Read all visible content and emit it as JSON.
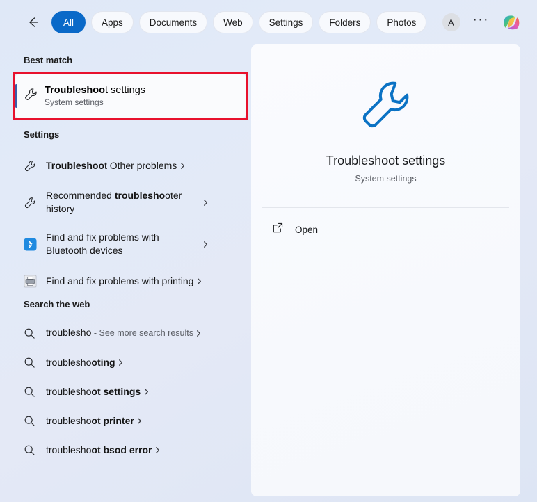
{
  "topbar": {
    "back_icon": "back-arrow-icon",
    "filters": [
      {
        "label": "All",
        "active": true
      },
      {
        "label": "Apps",
        "active": false
      },
      {
        "label": "Documents",
        "active": false
      },
      {
        "label": "Web",
        "active": false
      },
      {
        "label": "Settings",
        "active": false
      },
      {
        "label": "Folders",
        "active": false
      },
      {
        "label": "Photos",
        "active": false
      }
    ],
    "more_icon": "more-filters-arrow-icon",
    "avatar_initial": "A",
    "ellipsis": "···",
    "copilot_icon": "copilot-icon"
  },
  "query": "troublesho",
  "sections": {
    "best_match_header": "Best match",
    "settings_header": "Settings",
    "web_header": "Search the web"
  },
  "best_match": {
    "icon": "wrench-icon",
    "title_bold": "Troubleshoo",
    "title_rest": "t settings",
    "subtitle": "System settings"
  },
  "settings_results": [
    {
      "icon": "wrench-icon",
      "bold": "Troubleshoo",
      "rest": "t Other problems",
      "chevron": "chevron-right-icon"
    },
    {
      "icon": "wrench-icon",
      "pre": "Recommended ",
      "bold": "troublesho",
      "rest": "oter history",
      "chevron": "chevron-right-icon"
    },
    {
      "icon": "bluetooth-icon",
      "pre": "Find and fix problems with Bluetooth devices",
      "bold": "",
      "rest": "",
      "chevron": "chevron-right-icon"
    },
    {
      "icon": "printer-icon",
      "pre": "Find and fix problems with printing",
      "bold": "",
      "rest": "",
      "chevron": "chevron-right-icon"
    }
  ],
  "web_results": [
    {
      "icon": "search-icon",
      "query": "troublesho",
      "suffix": " - See more search results",
      "bold_suffix": "",
      "chevron": "chevron-right-icon"
    },
    {
      "icon": "search-icon",
      "query": "troublesho",
      "suffix": "",
      "bold_suffix": "oting",
      "chevron": "chevron-right-icon"
    },
    {
      "icon": "search-icon",
      "query": "troublesho",
      "suffix": "",
      "bold_suffix": "ot settings",
      "chevron": "chevron-right-icon"
    },
    {
      "icon": "search-icon",
      "query": "troublesho",
      "suffix": "",
      "bold_suffix": "ot printer",
      "chevron": "chevron-right-icon"
    },
    {
      "icon": "search-icon",
      "query": "troublesho",
      "suffix": "",
      "bold_suffix": "ot bsod error",
      "chevron": "chevron-right-icon"
    }
  ],
  "preview": {
    "icon": "wrench-icon-large",
    "title": "Troubleshoot settings",
    "subtitle": "System settings",
    "open_label": "Open",
    "open_icon": "external-link-icon"
  },
  "colors": {
    "accent_blue": "#0a69c8",
    "highlight_red": "#e8112d",
    "wrench_blue": "#0b72c4",
    "bluetooth_blue": "#1f8ae0",
    "selection_bar": "#3a5ea8"
  }
}
